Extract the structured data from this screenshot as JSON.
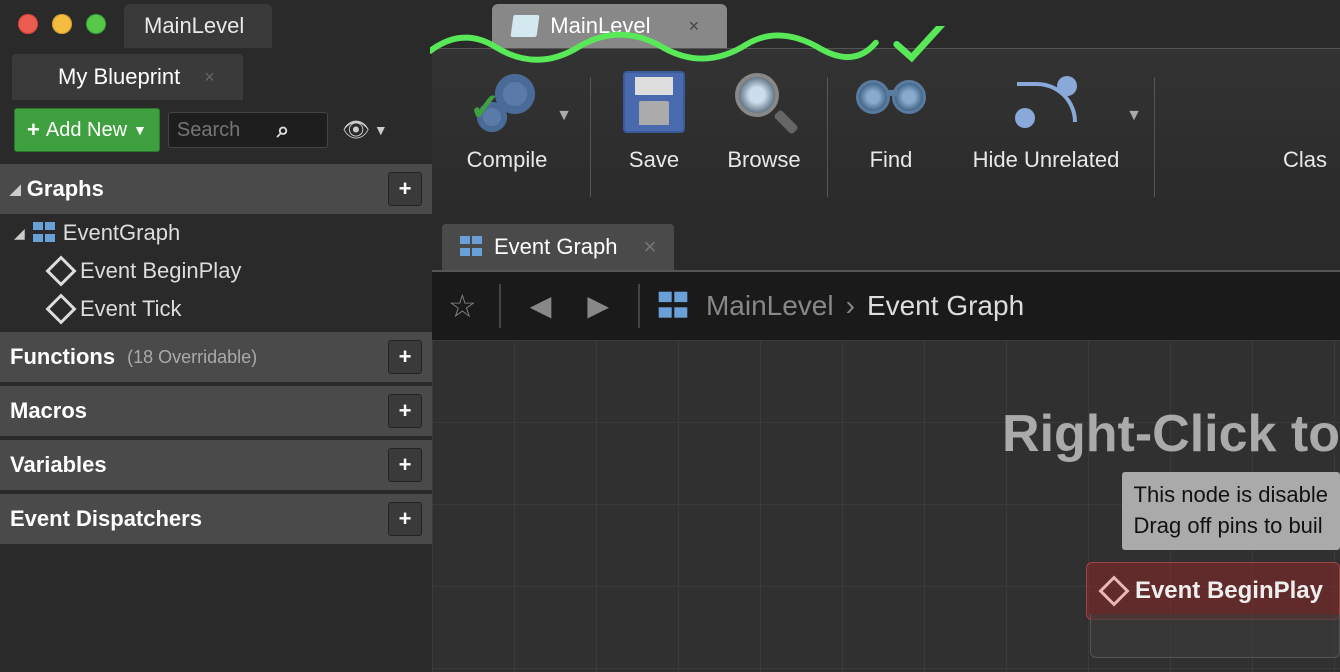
{
  "traffic": {
    "close": "#ec5b4f",
    "min": "#f5bd3f",
    "max": "#58c848"
  },
  "titlebar": {
    "tab1": "MainLevel",
    "tab2": "MainLevel"
  },
  "panel": {
    "title": "My Blueprint",
    "add_new": "Add New",
    "search_placeholder": "Search"
  },
  "categories": {
    "graphs": "Graphs",
    "eventgraph": "EventGraph",
    "event_beginplay": "Event BeginPlay",
    "event_tick": "Event Tick",
    "functions": "Functions",
    "functions_sub": "(18 Overridable)",
    "macros": "Macros",
    "variables": "Variables",
    "event_dispatchers": "Event Dispatchers"
  },
  "toolbar": {
    "compile": "Compile",
    "save": "Save",
    "browse": "Browse",
    "find": "Find",
    "hide_unrelated": "Hide Unrelated",
    "class": "Clas"
  },
  "graph": {
    "tab": "Event Graph",
    "crumb_level": "MainLevel",
    "crumb_graph": "Event Graph",
    "hint": "Right-Click to",
    "tooltip_l1": "This node is disable",
    "tooltip_l2": "Drag off pins to buil",
    "node_title": "Event BeginPlay"
  }
}
